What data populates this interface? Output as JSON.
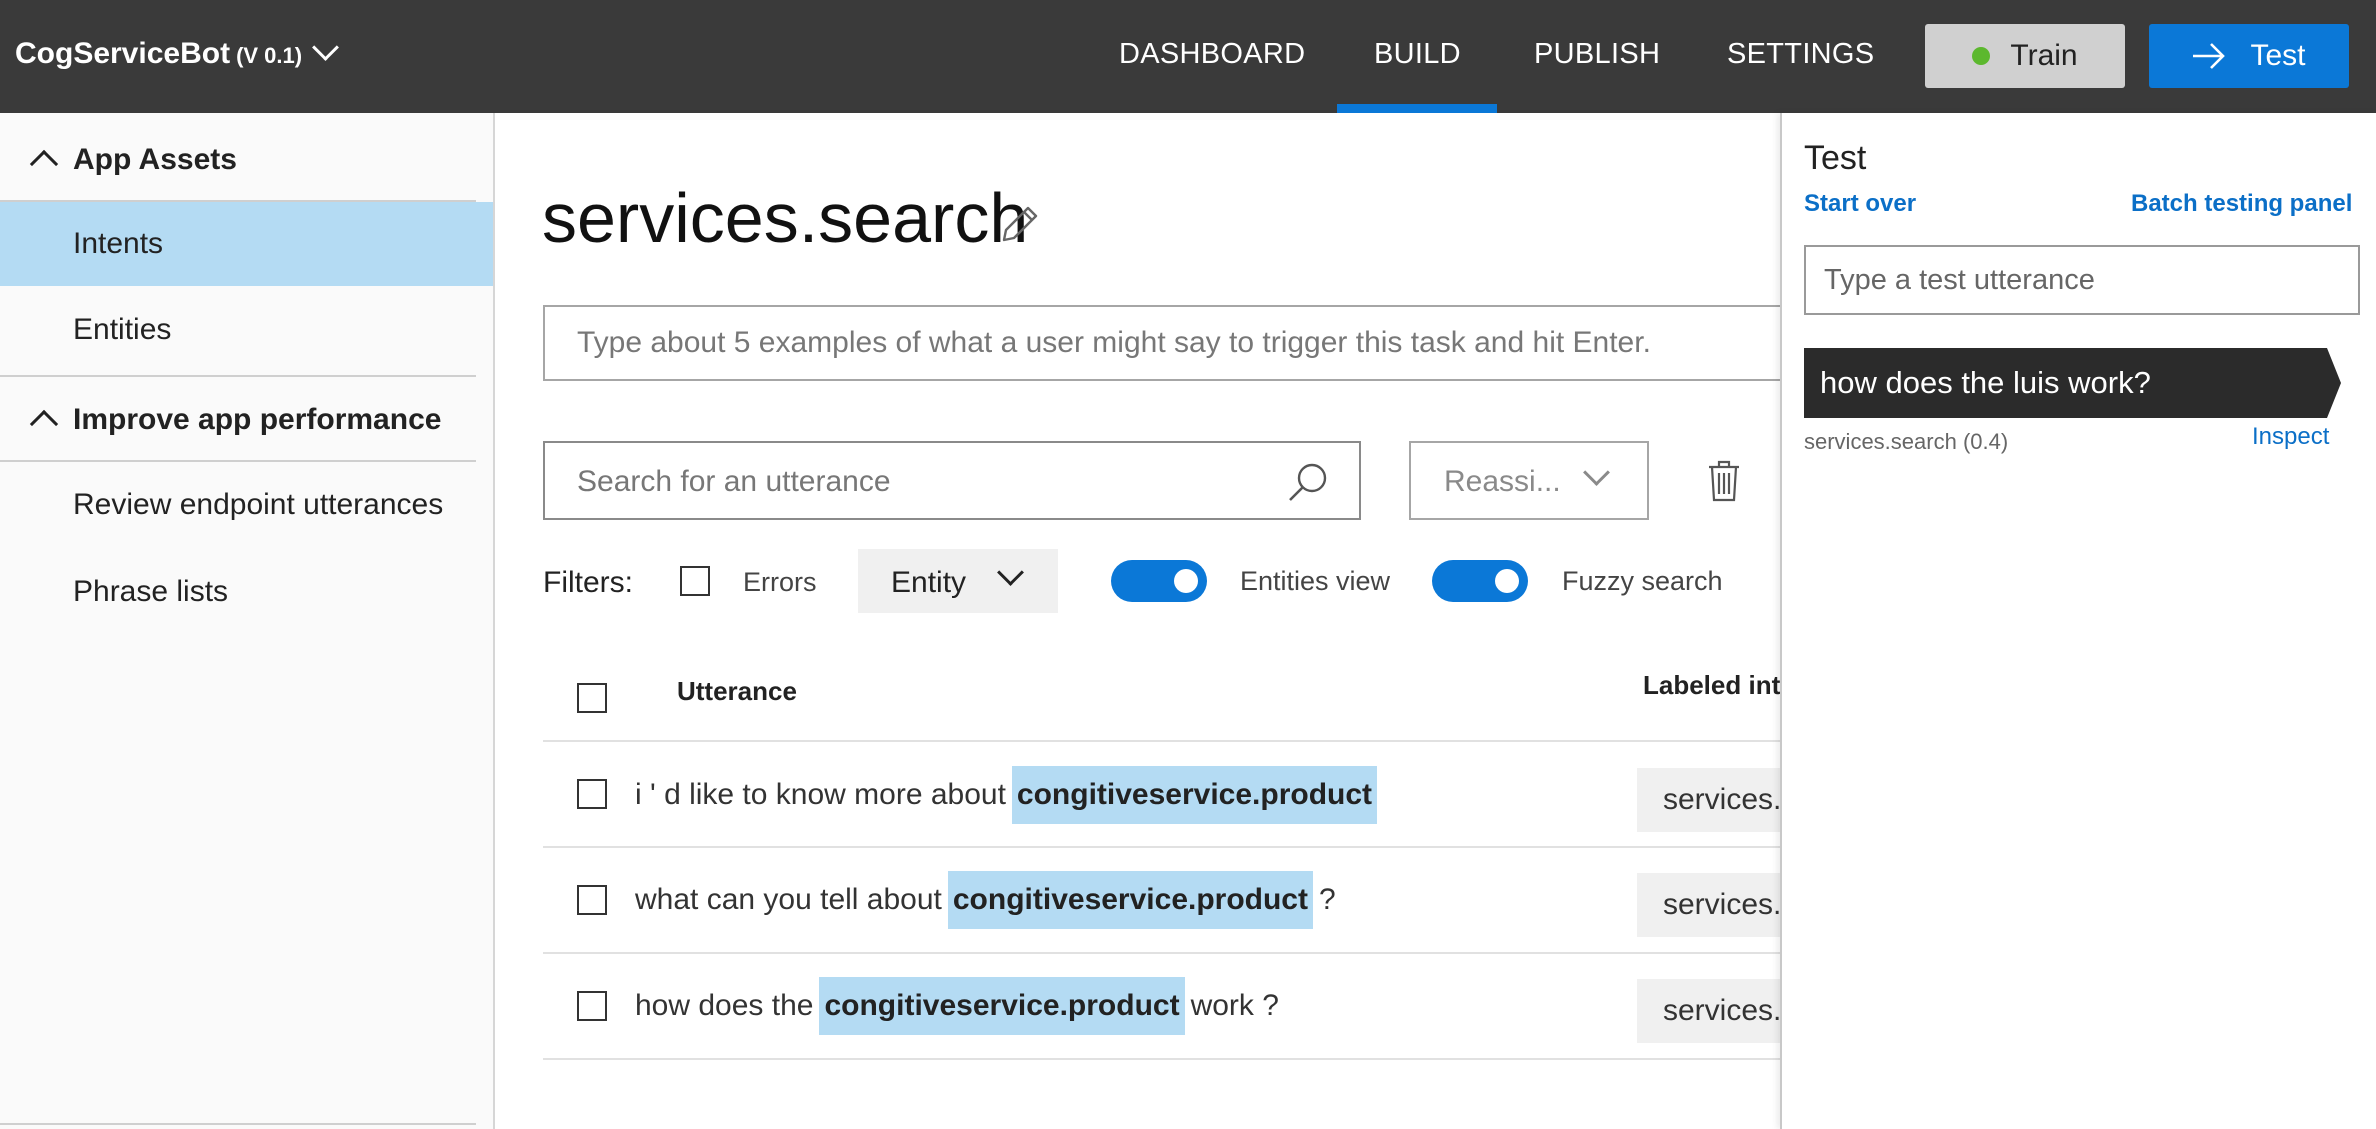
{
  "header": {
    "app_name": "CogServiceBot",
    "app_version": "(V 0.1)",
    "nav": {
      "dashboard": "DASHBOARD",
      "build": "BUILD",
      "publish": "PUBLISH",
      "settings": "SETTINGS"
    },
    "active_tab": "BUILD",
    "train_label": "Train",
    "test_label": "Test",
    "colors": {
      "bar": "#3a3a3a",
      "accent": "#0b78d7",
      "train_status": "#5cb82e"
    }
  },
  "sidebar": {
    "section_assets": "App Assets",
    "intents": "Intents",
    "entities": "Entities",
    "section_improve": "Improve app performance",
    "review": "Review endpoint utterances",
    "phrase_lists": "Phrase lists",
    "active_item": "Intents"
  },
  "main": {
    "title": "services.search",
    "example_placeholder": "Type about 5 examples of what a user might say to trigger this task and hit Enter.",
    "search_placeholder": "Search for an utterance",
    "reassign_placeholder": "Reassi...",
    "filters": {
      "label": "Filters:",
      "errors": "Errors",
      "entity": "Entity",
      "entities_view": "Entities view",
      "fuzzy_search": "Fuzzy search"
    },
    "table": {
      "col_utterance": "Utterance",
      "col_labeled": "Labeled int",
      "rows": [
        {
          "before": "i ' d like to know more about",
          "entity": "congitiveservice.product",
          "after": "",
          "intent": "services.search"
        },
        {
          "before": "what can you tell about",
          "entity": "congitiveservice.product",
          "after": "?",
          "intent": "services.search"
        },
        {
          "before": "how does the",
          "entity": "congitiveservice.product",
          "after": "work ?",
          "intent": "services.search"
        }
      ]
    }
  },
  "test_panel": {
    "title": "Test",
    "start_over": "Start over",
    "batch_testing": "Batch testing panel",
    "input_placeholder": "Type a test utterance",
    "utterance": "how does the luis work?",
    "result": "services.search (0.4)",
    "inspect": "Inspect"
  }
}
